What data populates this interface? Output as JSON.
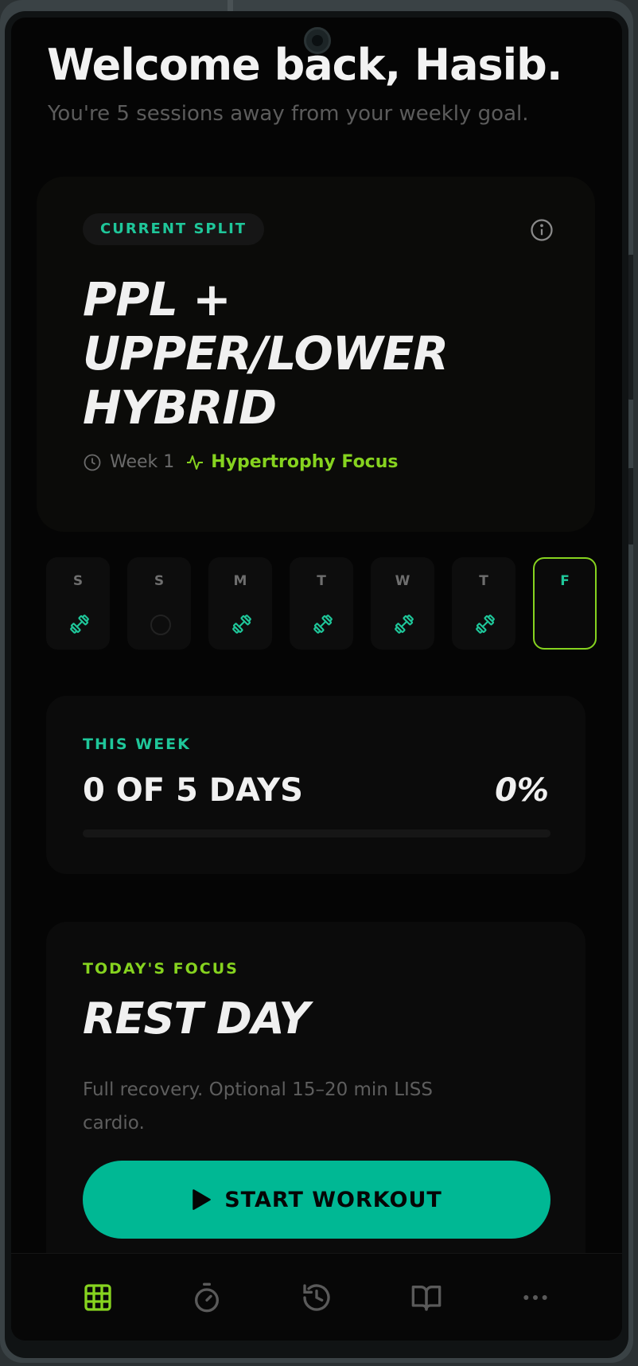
{
  "header": {
    "welcome": "Welcome back, Hasib.",
    "subtitle": "You're 5 sessions away from your weekly goal."
  },
  "split": {
    "badge": "CURRENT SPLIT",
    "title_line1": "PPL +",
    "title_line2": "UPPER/LOWER",
    "title_line3": "HYBRID",
    "week": "Week 1",
    "focus": "Hypertrophy Focus"
  },
  "days": [
    {
      "letter": "S",
      "status": "workout"
    },
    {
      "letter": "S",
      "status": "empty"
    },
    {
      "letter": "M",
      "status": "workout"
    },
    {
      "letter": "T",
      "status": "workout"
    },
    {
      "letter": "W",
      "status": "workout"
    },
    {
      "letter": "T",
      "status": "workout"
    },
    {
      "letter": "F",
      "status": "today"
    }
  ],
  "this_week": {
    "label": "THIS WEEK",
    "count": "0 OF 5 DAYS",
    "percent": "0%",
    "progress": 0
  },
  "today": {
    "label": "TODAY'S FOCUS",
    "title": "REST DAY",
    "description": "Full recovery. Optional 15–20 min LISS cardio.",
    "button": "START WORKOUT"
  },
  "nav": {
    "items": [
      "grid-icon",
      "stopwatch-icon",
      "history-icon",
      "book-icon",
      "more-icon"
    ],
    "active": 0
  },
  "colors": {
    "teal": "#1fc79a",
    "green": "#86d31f",
    "button": "#00b894",
    "background": "#050505"
  }
}
